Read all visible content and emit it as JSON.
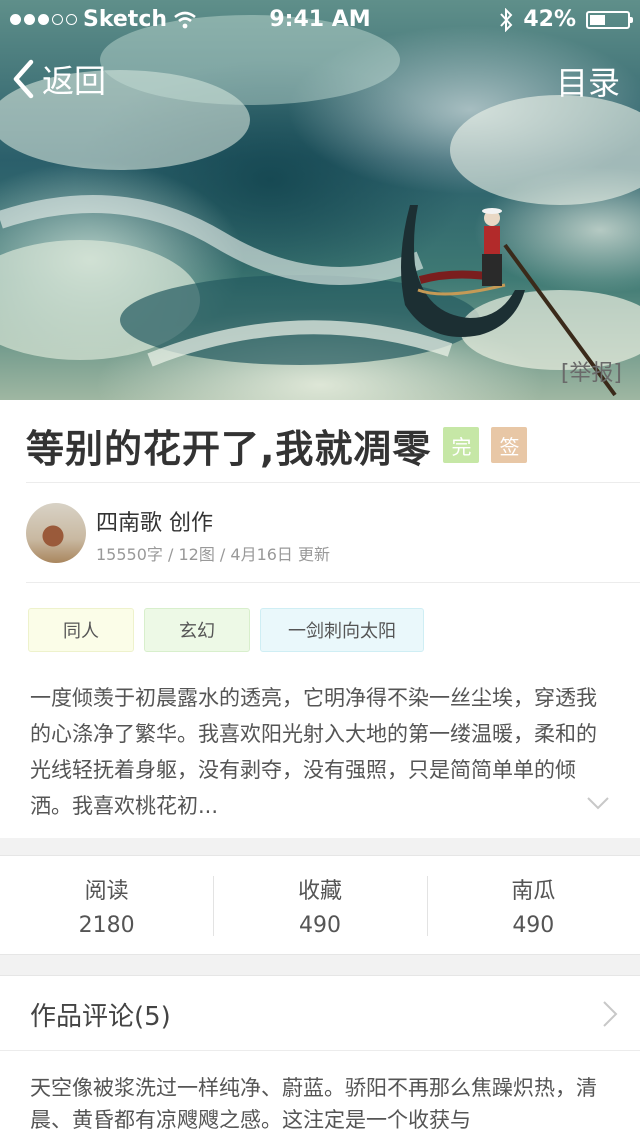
{
  "status_bar": {
    "carrier": "Sketch",
    "time": "9:41 AM",
    "battery": "42%",
    "battery_level": 0.42
  },
  "nav": {
    "back_label": "返回",
    "toc_label": "目录"
  },
  "hero": {
    "report_label": "[举报]"
  },
  "book": {
    "title": "等别的花开了,我就凋零",
    "badge_done": "完",
    "badge_signed": "签",
    "author_line": "四南歌 创作",
    "meta": "15550字 / 12图 / 4月16日 更新",
    "tags": [
      "同人",
      "玄幻",
      "一剑刺向太阳"
    ],
    "description": "一度倾羡于初晨露水的透亮，它明净得不染一丝尘埃，穿透我的心涤净了繁华。我喜欢阳光射入大地的第一缕温暖，柔和的光线轻抚着身躯，没有剥夺，没有强照，只是简简单单的倾洒。我喜欢桃花初..."
  },
  "stats": [
    {
      "label": "阅读",
      "value": "2180"
    },
    {
      "label": "收藏",
      "value": "490"
    },
    {
      "label": "南瓜",
      "value": "490"
    }
  ],
  "comments": {
    "title": "作品评论(5)",
    "preview": "天空像被浆洗过一样纯净、蔚蓝。骄阳不再那么焦躁炽热，清晨、黄昏都有凉飕飕之感。这注定是一个收获与"
  },
  "colors": {
    "badge_done": "#c6e7a6",
    "badge_signed": "#e8c7a6",
    "divider": "#ececec",
    "band": "#f2f2f2"
  },
  "icons": [
    "back-chevron-icon",
    "wifi-icon",
    "bluetooth-icon",
    "battery-icon",
    "chevron-down-icon",
    "chevron-right-icon"
  ]
}
